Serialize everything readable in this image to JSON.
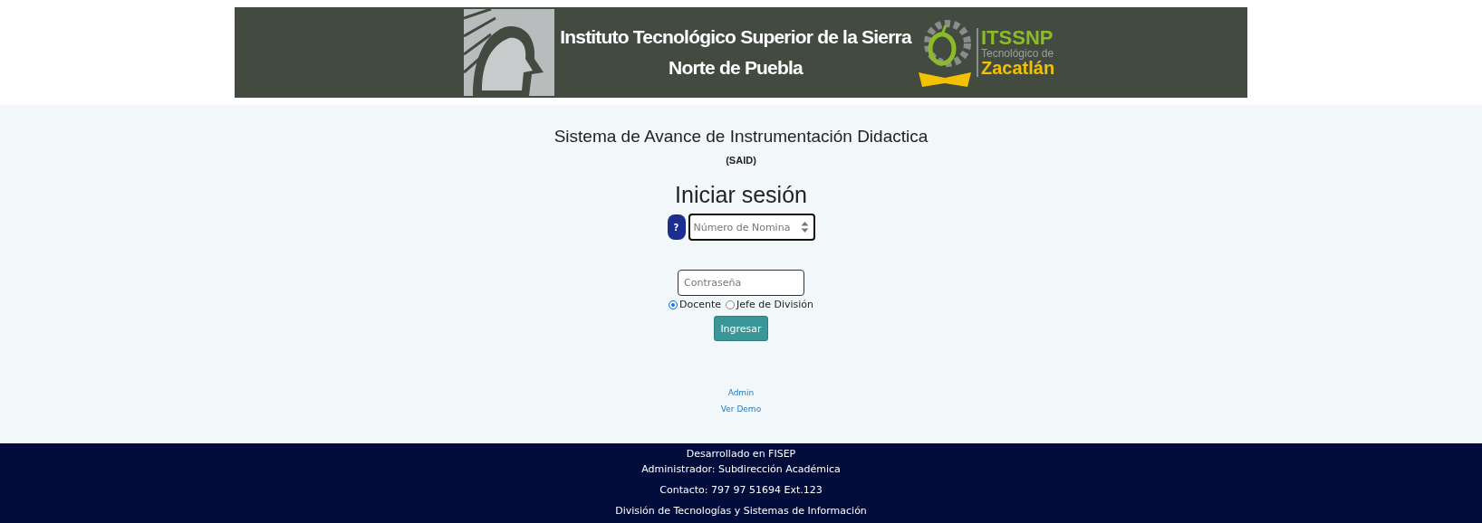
{
  "banner": {
    "institute_name": [
      "Instituto Tecnológico Superior de la Sierra",
      "Norte de Puebla"
    ],
    "logo_acronym": "ITSSNP",
    "logo_subtitle": "Tecnológico de",
    "logo_city": "Zacatlán"
  },
  "header": {
    "title": "Sistema de Avance de Instrumentación Didactica",
    "acronym": "(SAID)"
  },
  "login": {
    "heading": "Iniciar sesión",
    "help_button": "?",
    "payroll_field": {
      "placeholder": "Número de Nomina"
    },
    "password_field": {
      "placeholder": "Contraseña"
    },
    "roles": [
      {
        "label": "Docente",
        "selected": true
      },
      {
        "label": "Jefe de División",
        "selected": false
      }
    ],
    "submit": "Ingresar"
  },
  "links": [
    "Admin",
    "Ver Demo"
  ],
  "footer": {
    "lines": [
      "Desarrollado en FISEP",
      "Administrador: Subdirección Académica",
      "Contacto: 797 97 51694 Ext.123",
      "División de Tecnologías y Sistemas de Información"
    ]
  }
}
